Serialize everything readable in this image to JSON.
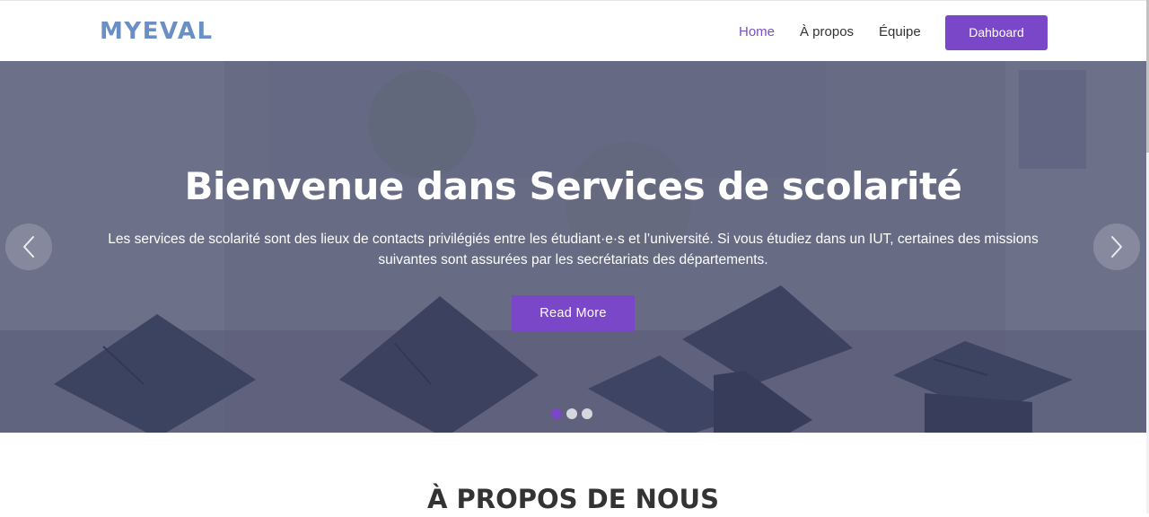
{
  "navbar": {
    "brand": "MYEVAL",
    "links": [
      {
        "label": "Home",
        "active": true
      },
      {
        "label": "À propos",
        "active": false
      },
      {
        "label": "Équipe",
        "active": false
      }
    ],
    "dashboard_label": "Dahboard"
  },
  "hero": {
    "title": "Bienvenue dans Services de scolarité",
    "text": "Les services de scolarité sont des lieux de contacts privilégiés entre les étudiant·e·s et l’université. Si vous étudiez dans un IUT, certaines des missions suivantes sont assurées par les secrétariats des départements.",
    "button_label": "Read More",
    "prev_icon": "chevron-left-icon",
    "next_icon": "chevron-right-icon",
    "slides_count": 3,
    "active_slide": 1
  },
  "about": {
    "title": "À PROPOS DE NOUS"
  },
  "colors": {
    "accent": "#7a47c8",
    "brand": "#6a8fc4"
  }
}
